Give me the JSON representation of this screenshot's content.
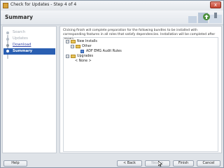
{
  "window": {
    "title": "Check for Updates - Step 4 of 4",
    "close_label": "x"
  },
  "banner": {
    "title": "Summary"
  },
  "steps": [
    {
      "label": "Search",
      "state": "done"
    },
    {
      "label": "Updates",
      "state": "done"
    },
    {
      "label": "Download",
      "state": "link"
    },
    {
      "label": "Summary",
      "state": "active"
    }
  ],
  "content": {
    "description": "Clicking finish will complete preparation for the following bundles to be installed with corresponding features in all roles that satisfy dependencies. Installation will be completed after restart.",
    "tree": {
      "new_installs": "New Installs",
      "other": "Other",
      "bundle": "ADF EMG Audit Rules",
      "upgrades": "Upgrades",
      "none": "< None >"
    }
  },
  "buttons": {
    "help": "Help",
    "back": "< Back",
    "next": "Next >",
    "finish": "Finish",
    "cancel": "Cancel"
  },
  "colors": {
    "active_step": "#2a5fb2",
    "link": "#3a4aa8"
  }
}
